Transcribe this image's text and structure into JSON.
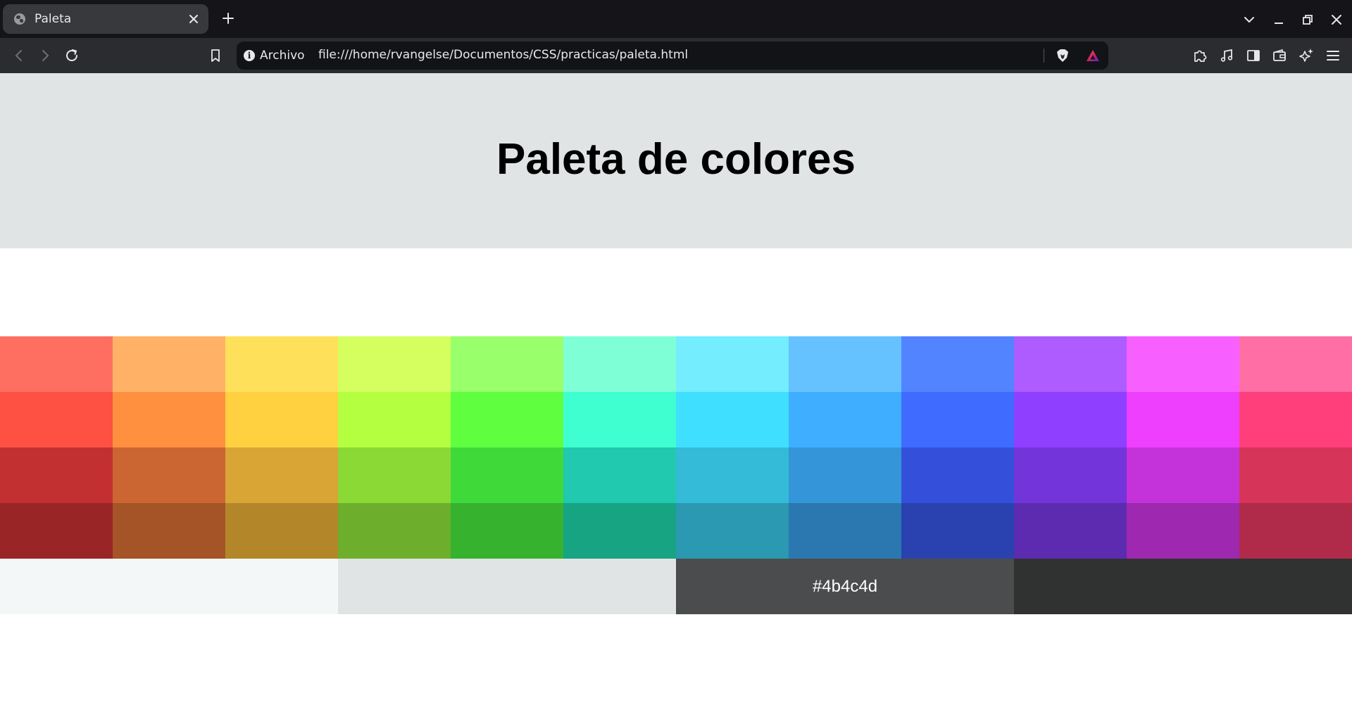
{
  "browser": {
    "tab": {
      "title": "Paleta"
    },
    "address_bar": {
      "site_label": "Archivo",
      "url": "file:///home/rvangelse/Documentos/CSS/practicas/paleta.html"
    }
  },
  "page": {
    "title": "Paleta de colores",
    "palette": {
      "rows": [
        [
          "#ff6f61",
          "#ffb266",
          "#ffe05b",
          "#d4ff5f",
          "#99ff6b",
          "#7fffd6",
          "#74edff",
          "#66c2ff",
          "#5284ff",
          "#ae5cff",
          "#f760ff",
          "#ff6fa5"
        ],
        [
          "#ff5044",
          "#ff9040",
          "#ffd040",
          "#b4ff40",
          "#5fff40",
          "#3fffd1",
          "#3fe0ff",
          "#40aeff",
          "#3f6bff",
          "#8f3fff",
          "#ee3fff",
          "#ff3f7b"
        ],
        [
          "#c23032",
          "#cb6633",
          "#d9a534",
          "#8ad934",
          "#40d93a",
          "#21c9ae",
          "#33bbd8",
          "#3595d9",
          "#3450da",
          "#7335d9",
          "#c333d9",
          "#d63458"
        ],
        [
          "#9a2526",
          "#a55428",
          "#b3862a",
          "#6daf2c",
          "#37b22f",
          "#17a483",
          "#2a99b1",
          "#2b78b0",
          "#2a42b0",
          "#5c2bb0",
          "#9e29b0",
          "#b02a4a"
        ]
      ],
      "neutrals": [
        {
          "color": "#f4f7f8",
          "label": ""
        },
        {
          "color": "#e1e4e5",
          "label": ""
        },
        {
          "color": "#4b4c4d",
          "label": "#4b4c4d"
        },
        {
          "color": "#303232",
          "label": ""
        }
      ]
    }
  }
}
